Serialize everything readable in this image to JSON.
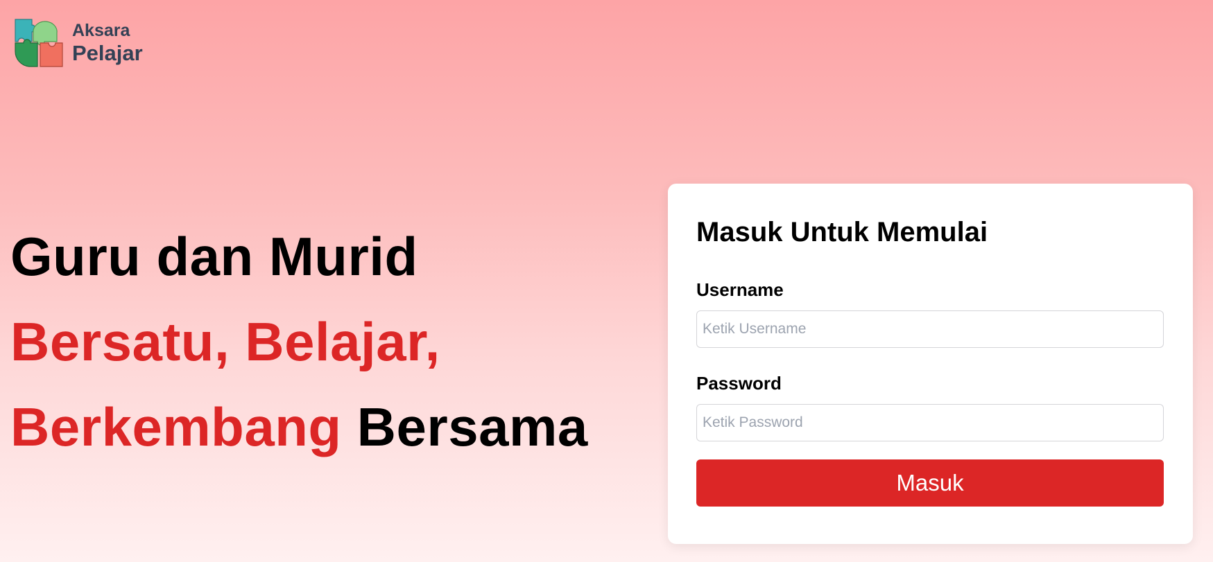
{
  "brand": {
    "line1": "Aksara",
    "line2": "Pelajar",
    "logo_icon": "puzzle-logo-icon"
  },
  "hero": {
    "line1": "Guru dan Murid",
    "line2": "Bersatu, Belajar,",
    "line3_red": "Berkembang",
    "line3_dark": "Bersama"
  },
  "login": {
    "title": "Masuk Untuk Memulai",
    "username_label": "Username",
    "username_placeholder": "Ketik Username",
    "username_value": "",
    "password_label": "Password",
    "password_placeholder": "Ketik Password",
    "password_value": "",
    "submit_label": "Masuk"
  },
  "colors": {
    "accent": "#dc2626",
    "brand_text": "#334155",
    "background_top": "#fda4a6",
    "background_bottom": "#fff0f0"
  }
}
